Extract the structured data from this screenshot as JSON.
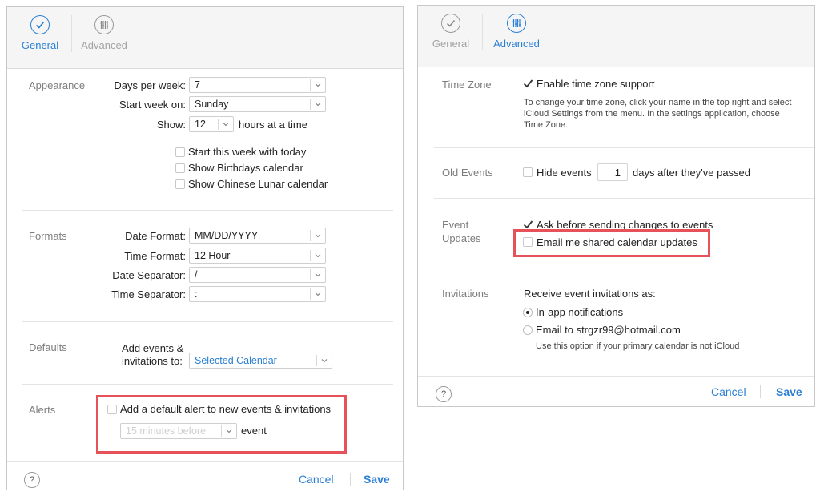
{
  "colors": {
    "accent": "#2a7fd4",
    "highlight": "#e5525a",
    "muted_text": "#7d7d7d"
  },
  "left": {
    "tabs": [
      {
        "label": "General",
        "icon": "checkmark-icon",
        "active": true
      },
      {
        "label": "Advanced",
        "icon": "sliders-icon",
        "active": false
      }
    ],
    "appearance": {
      "section": "Appearance",
      "days_per_week_label": "Days per week:",
      "days_per_week_value": "7",
      "start_week_label": "Start week on:",
      "start_week_value": "Sunday",
      "show_label": "Show:",
      "show_value": "12",
      "show_suffix": "hours at a time",
      "cb_start_today": "Start this week with today",
      "cb_birthdays": "Show Birthdays calendar",
      "cb_chinese_lunar": "Show Chinese Lunar calendar"
    },
    "formats": {
      "section": "Formats",
      "date_format_label": "Date Format:",
      "date_format_value": "MM/DD/YYYY",
      "time_format_label": "Time Format:",
      "time_format_value": "12 Hour",
      "date_sep_label": "Date Separator:",
      "date_sep_value": "/",
      "time_sep_label": "Time Separator:",
      "time_sep_value": ":"
    },
    "defaults": {
      "section": "Defaults",
      "add_events_label_1": "Add events &",
      "add_events_label_2": "invitations to:",
      "calendar_value": "Selected Calendar"
    },
    "alerts": {
      "section": "Alerts",
      "cb_default_alert": "Add a default alert to new events & invitations",
      "alert_time_value": "15 minutes before",
      "alert_suffix": "event"
    },
    "footer": {
      "help": "?",
      "cancel": "Cancel",
      "save": "Save"
    }
  },
  "right": {
    "tabs": [
      {
        "label": "General",
        "icon": "checkmark-icon",
        "active": false
      },
      {
        "label": "Advanced",
        "icon": "sliders-icon",
        "active": true
      }
    ],
    "time_zone": {
      "section": "Time Zone",
      "cb_enable": "Enable time zone support",
      "help_line_1": "To change your time zone, click your name in the top right and select",
      "help_line_2": "iCloud Settings from the menu. In the settings application, choose",
      "help_line_3": "Time Zone."
    },
    "old_events": {
      "section": "Old Events",
      "cb_hide": "Hide events",
      "days_value": "1",
      "suffix": "days after they've passed"
    },
    "event_updates": {
      "section_line_1": "Event",
      "section_line_2": "Updates",
      "cb_ask": "Ask before sending changes to events",
      "cb_email_shared": "Email me shared calendar updates"
    },
    "invitations": {
      "section": "Invitations",
      "receive_label": "Receive event invitations as:",
      "radio_inapp": "In-app notifications",
      "radio_email": "Email to strgzr99@hotmail.com",
      "email_note": "Use this option if your primary calendar is not iCloud"
    },
    "footer": {
      "help": "?",
      "cancel": "Cancel",
      "save": "Save"
    }
  }
}
